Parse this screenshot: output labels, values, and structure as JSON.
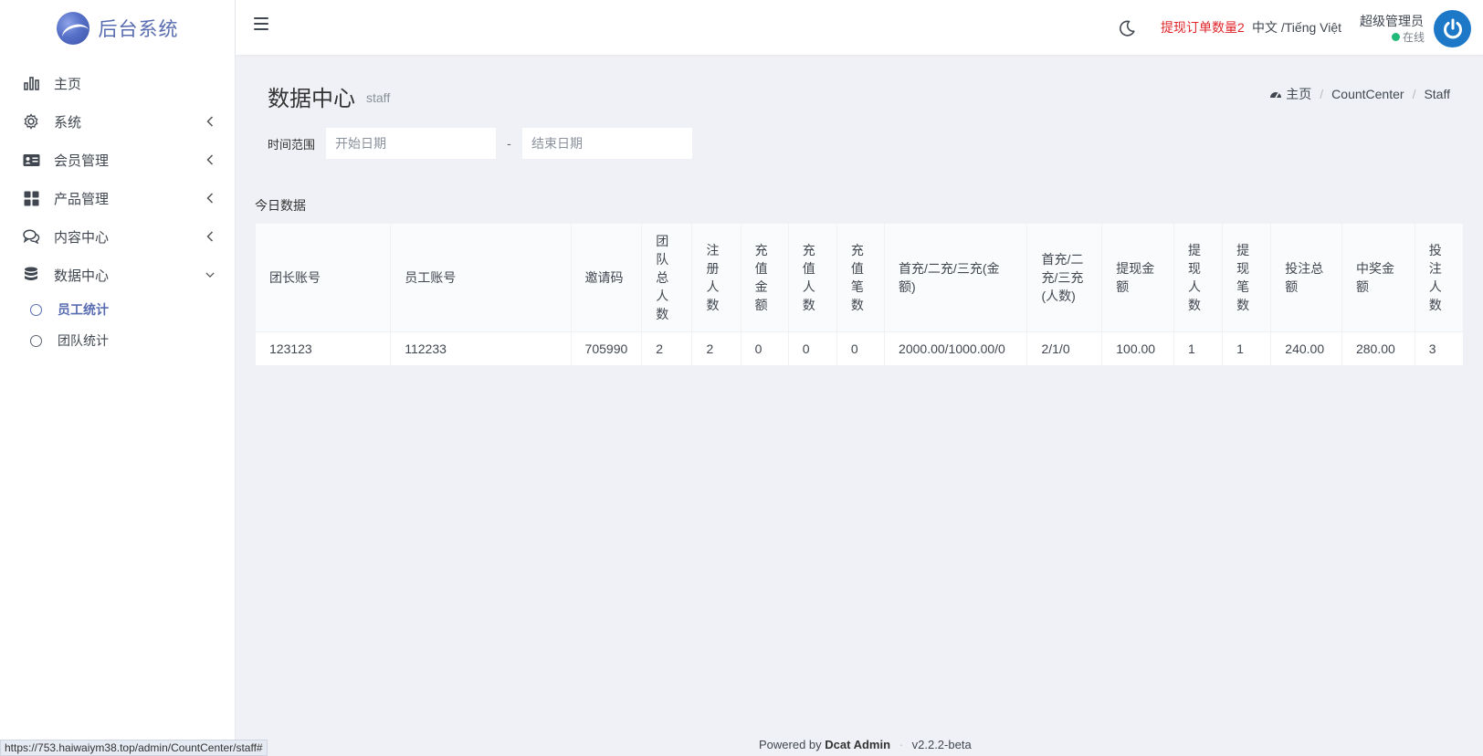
{
  "brand": {
    "name": "后台系统"
  },
  "sidebar": {
    "items": [
      {
        "label": "主页",
        "icon": "bar-chart-icon"
      },
      {
        "label": "系统",
        "icon": "gear-icon"
      },
      {
        "label": "会员管理",
        "icon": "id-card-icon"
      },
      {
        "label": "产品管理",
        "icon": "grid-icon"
      },
      {
        "label": "内容中心",
        "icon": "chat-icon"
      },
      {
        "label": "数据中心",
        "icon": "database-icon"
      }
    ],
    "sub_items": [
      {
        "label": "员工统计",
        "active": true
      },
      {
        "label": "团队统计",
        "active": false
      }
    ]
  },
  "header": {
    "withdraw_notice": "提现订单数量2",
    "language": "中文 /Tiếng Việt",
    "user_name": "超级管理员",
    "user_status": "在线"
  },
  "page": {
    "title": "数据中心",
    "subtitle": "staff",
    "breadcrumb": [
      "主页",
      "CountCenter",
      "Staff"
    ]
  },
  "filter": {
    "label": "时间范围",
    "start_placeholder": "开始日期",
    "end_placeholder": "结束日期",
    "separator": "-"
  },
  "section_title": "今日数据",
  "table": {
    "columns": [
      "团长账号",
      "员工账号",
      "邀请码",
      "团队总人数",
      "注册人数",
      "充值金额",
      "充值人数",
      "充值笔数",
      "首充/二充/三充(金额)",
      "首充/二充/三充(人数)",
      "提现金额",
      "提现人数",
      "提现笔数",
      "投注总额",
      "中奖金额",
      "投注人数"
    ],
    "rows": [
      [
        "123123",
        "112233",
        "705990",
        "2",
        "2",
        "0",
        "0",
        "0",
        "2000.00/1000.00/0",
        "2/1/0",
        "100.00",
        "1",
        "1",
        "240.00",
        "280.00",
        "3"
      ]
    ]
  },
  "footer": {
    "powered_by": "Powered by",
    "product": "Dcat Admin",
    "separator": "·",
    "version": "v2.2.2-beta"
  },
  "statusbar_url": "https://753.haiwaiym38.top/admin/CountCenter/staff#",
  "colors": {
    "accent": "#586cb1",
    "warning": "#e0262b",
    "online": "#21b978",
    "avatar_bg": "#1e78c8"
  }
}
